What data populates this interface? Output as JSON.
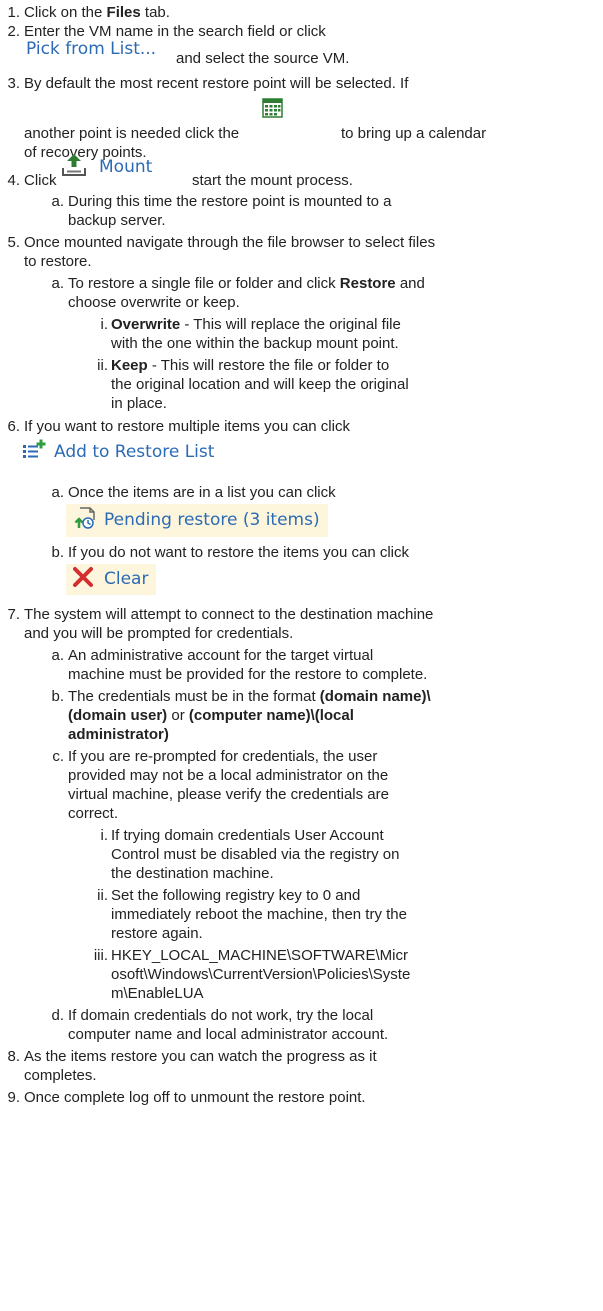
{
  "steps": {
    "s1": {
      "num": "1.",
      "text_a": "Click on the ",
      "bold": "Files",
      "text_b": " tab."
    },
    "s2": {
      "num": "2.",
      "line1": "Enter the VM name in the search field or click",
      "button": "Pick from List...",
      "after": "and select the source VM."
    },
    "s3": {
      "num": "3.",
      "line1": "By default the most recent restore point will be selected. If",
      "line2_a": "another point is needed click the",
      "line2_b": "to bring up a calendar",
      "line3": "of recovery points.",
      "icon": "calendar-icon"
    },
    "s4": {
      "num": "4.",
      "click": "Click",
      "button": "Mount",
      "after": "start the mount process.",
      "icon": "upload-icon",
      "a": {
        "num": "a.",
        "line1": "During this time the restore point is mounted to a",
        "line2": "backup server."
      }
    },
    "s5": {
      "num": "5.",
      "line1": "Once mounted navigate through the file browser to select files",
      "line2": "to restore.",
      "a": {
        "num": "a.",
        "line1_a": "To restore a single file or folder and click ",
        "line1_bold": "Restore",
        "line1_b": " and",
        "line2": "choose overwrite or keep."
      },
      "i": {
        "num": "i.",
        "bold": "Overwrite",
        "line1": " - This will replace the original file",
        "line2": "with the one within the backup mount point."
      },
      "ii": {
        "num": "ii.",
        "bold": "Keep",
        "line1": " - This will restore the file or folder to",
        "line2": "the original location and will keep the original",
        "line3": "in place."
      }
    },
    "s6": {
      "num": "6.",
      "line1": "If you want to restore multiple items you can click",
      "button": "Add to Restore List",
      "icon": "add-list-icon",
      "a": {
        "num": "a.",
        "text": "Once the items are in a list you can click",
        "button": "Pending restore (3 items)",
        "icon": "restore-clock-icon"
      },
      "b": {
        "num": "b.",
        "text": "If you do not want to restore the items you can click",
        "button": "Clear",
        "icon": "close-x-icon"
      }
    },
    "s7": {
      "num": "7.",
      "line1": "The system will attempt to connect to the destination machine",
      "line2": "and you will be prompted for credentials.",
      "a": {
        "num": "a.",
        "line1": "An administrative account for the target virtual",
        "line2": "machine must be provided for the restore to complete."
      },
      "b": {
        "num": "b.",
        "line1_a": "The credentials must be in the format ",
        "line1_bold": "(domain name)\\",
        "line2_bold_a": "(domain user)",
        "line2_mid": " or ",
        "line2_bold_b": "(computer name)\\(local",
        "line3_bold": "administrator)"
      },
      "c": {
        "num": "c.",
        "line1": "If you are re-prompted for credentials, the user",
        "line2": "provided may not be a local administrator on the",
        "line3": "virtual machine, please verify the credentials are",
        "line4": "correct."
      },
      "ci": {
        "num": "i.",
        "line1": "If trying domain credentials User Account",
        "line2": "Control must be disabled via the registry on",
        "line3": "the destination machine."
      },
      "cii": {
        "num": "ii.",
        "line1": "Set the following registry key to 0 and",
        "line2": "immediately reboot the machine, then try the",
        "line3": "restore again."
      },
      "ciii": {
        "num": "iii.",
        "line1": "HKEY_LOCAL_MACHINE\\SOFTWARE\\Micr",
        "line2": "osoft\\Windows\\CurrentVersion\\Policies\\Syste",
        "line3": "m\\EnableLUA"
      },
      "d": {
        "num": "d.",
        "line1": "If domain credentials do not work, try the local",
        "line2": "computer name and local administrator account."
      }
    },
    "s8": {
      "num": "8.",
      "line1": "As the items restore you can watch the progress as it",
      "line2": "completes."
    },
    "s9": {
      "num": "9.",
      "line1": "Once complete log off to unmount the restore point."
    }
  },
  "colors": {
    "link_blue": "#2b6bb5",
    "highlight": "#fdf6dc",
    "calendar_green": "#2e7d32",
    "clear_red": "#d32f2f"
  }
}
